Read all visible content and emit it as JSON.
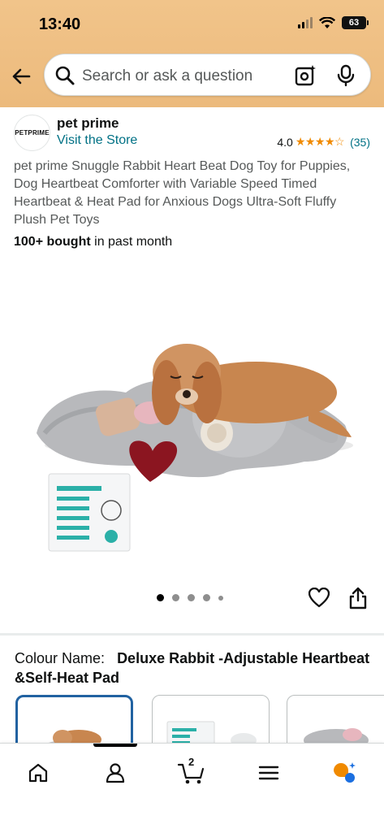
{
  "status_bar": {
    "time": "13:40",
    "battery": "63"
  },
  "search": {
    "placeholder": "Search or ask a question"
  },
  "store": {
    "logo_text": "PETPRIME",
    "name": "pet prime",
    "link": "Visit the Store",
    "rating_value": "4.0",
    "stars": "★★★★☆",
    "rating_count": "(35)"
  },
  "product": {
    "title": "pet prime Snuggle Rabbit Heart Beat Dog Toy for Puppies, Dog Heartbeat Comforter with Variable Speed Timed Heartbeat & Heat Pad for Anxious Dogs Ultra-Soft Fluffy Plush Pet Toys",
    "bought_bold": "100+ bought",
    "bought_rest": " in past month",
    "image_count": 5,
    "active_image": 1
  },
  "variation": {
    "label": "Colour Name:",
    "value": "Deluxe Rabbit -Adjustable Heartbeat &Self-Heat Pad"
  },
  "bottom_nav": {
    "cart_count": "2"
  },
  "colors": {
    "header": "#ecba7c",
    "link": "#007185",
    "star": "#f08a00",
    "selected_border": "#2162a1"
  }
}
